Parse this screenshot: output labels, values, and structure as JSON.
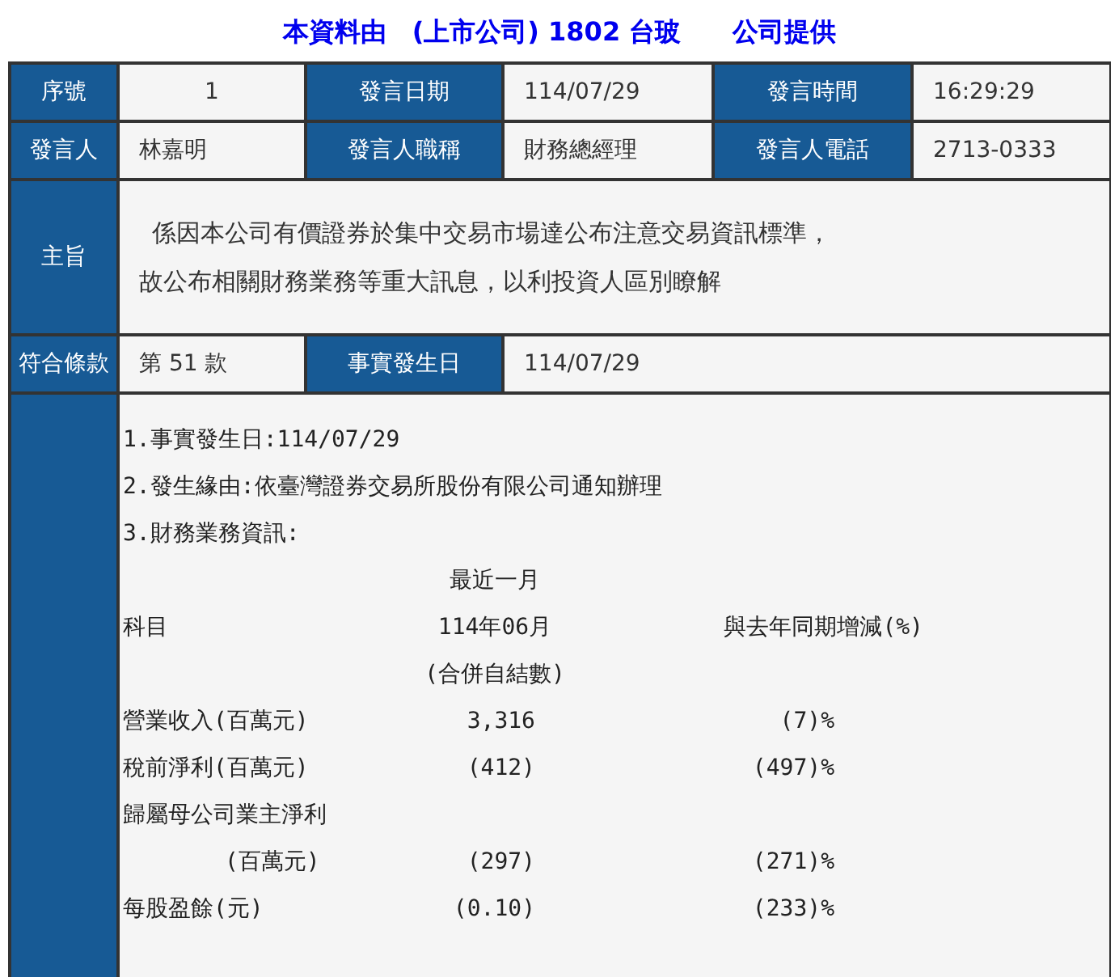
{
  "title": "本資料由　(上市公司) 1802 台玻　　公司提供",
  "info_rows": [
    [
      {
        "label": "序號",
        "value": "1"
      },
      {
        "label": "發言日期",
        "value": "114/07/29"
      },
      {
        "label": "發言時間",
        "value": "16:29:29"
      }
    ],
    [
      {
        "label": "發言人",
        "value": "林嘉明"
      },
      {
        "label": "發言人職稱",
        "value": "財務總經理"
      },
      {
        "label": "發言人電話",
        "value": "2713-0333"
      }
    ]
  ],
  "subject": {
    "label": "主旨",
    "text": "係因本公司有價證券於集中交易市場達公布注意交易資訊標準，故公布相關財務業務等重大訊息，以利投資人區別瞭解"
  },
  "clause": {
    "label": "符合條款",
    "value": "第 51 款",
    "date_label": "事實發生日",
    "date": "114/07/29"
  },
  "body": {
    "lines": [
      "1.事實發生日:114/07/29",
      "2.發生緣由:依臺灣證券交易所股份有限公司通知辦理",
      "3.財務業務資訊:"
    ],
    "table": [
      {
        "kind": "header",
        "month": "最近一月"
      },
      {
        "kind": "header",
        "item": "科目",
        "month": "114年06月",
        "change": "與去年同期增減(%)"
      },
      {
        "kind": "header",
        "month": "(合併自結數)"
      },
      {
        "kind": "data",
        "item": "營業收入(百萬元)",
        "month": "3,316",
        "change": "(7)%"
      },
      {
        "kind": "data",
        "item": "稅前淨利(百萬元)",
        "month": "(412)",
        "change": "(497)%"
      },
      {
        "kind": "data",
        "item": "歸屬母公司業主淨利"
      },
      {
        "kind": "continuation",
        "item": "(百萬元)",
        "month": "(297)",
        "change": "(271)%"
      },
      {
        "kind": "data",
        "item": "每股盈餘(元)",
        "month": "(0.10)",
        "change": "(233)%"
      }
    ]
  }
}
